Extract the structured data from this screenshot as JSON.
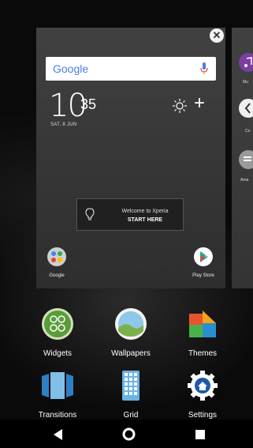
{
  "home_page_preview": {
    "search": {
      "logo_text": "Google"
    },
    "clock": {
      "hour": "10",
      "minutes": "35",
      "date": "SAT, 8 JUN"
    },
    "welcome": {
      "line1": "Welcome to Xperia",
      "line2": "START HERE"
    },
    "apps": [
      {
        "label": "Google",
        "icon": "google-folder-icon"
      },
      {
        "label": "Play Store",
        "icon": "play-store-icon"
      }
    ],
    "close_icon": "close-icon"
  },
  "next_page_preview": {
    "apps": [
      {
        "label": "Mu",
        "icon": "music-icon"
      },
      {
        "label": "Co",
        "icon": "contacts-icon"
      },
      {
        "label": "Ama",
        "icon": "amazon-icon"
      }
    ]
  },
  "options": [
    {
      "label": "Widgets",
      "icon": "widgets-icon"
    },
    {
      "label": "Wallpapers",
      "icon": "wallpapers-icon"
    },
    {
      "label": "Themes",
      "icon": "themes-icon"
    },
    {
      "label": "Transitions",
      "icon": "transitions-icon"
    },
    {
      "label": "Grid",
      "icon": "grid-icon"
    },
    {
      "label": "Settings",
      "icon": "settings-icon"
    }
  ],
  "navbar": {
    "buttons": [
      "back-icon",
      "home-icon",
      "recents-icon"
    ]
  },
  "colors": {
    "accent_green": "#5a9b3a",
    "settings_blue": "#1e5aa8"
  }
}
